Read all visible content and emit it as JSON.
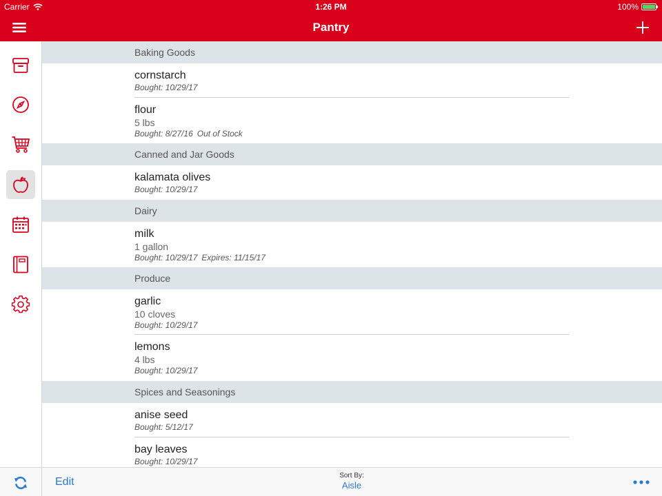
{
  "status_bar": {
    "carrier": "Carrier",
    "time": "1:26 PM",
    "battery": "100%",
    "battery_color": "#4cd964"
  },
  "nav_bar": {
    "title": "Pantry",
    "left_icon": "hamburger-menu-icon",
    "right_icon": "plus-icon",
    "color": "#d9001b"
  },
  "sidebar": {
    "items": [
      {
        "icon": "archive-box-icon",
        "active": false
      },
      {
        "icon": "compass-icon",
        "active": false
      },
      {
        "icon": "shopping-cart-icon",
        "active": false
      },
      {
        "icon": "apple-icon",
        "active": true
      },
      {
        "icon": "calendar-icon",
        "active": false
      },
      {
        "icon": "notebook-icon",
        "active": false
      },
      {
        "icon": "gear-icon",
        "active": false
      }
    ],
    "icon_color": "#d9001b"
  },
  "sections": [
    {
      "title": "Baking Goods",
      "items": [
        {
          "name": "cornstarch",
          "qty": "",
          "bought": "Bought: 10/29/17",
          "extra": ""
        },
        {
          "name": "flour",
          "qty": "5 lbs",
          "bought": "Bought: 8/27/16",
          "extra": "Out of Stock"
        }
      ]
    },
    {
      "title": "Canned and Jar Goods",
      "items": [
        {
          "name": "kalamata olives",
          "qty": "",
          "bought": "Bought: 10/29/17",
          "extra": ""
        }
      ]
    },
    {
      "title": "Dairy",
      "items": [
        {
          "name": "milk",
          "qty": "1 gallon",
          "bought": "Bought: 10/29/17",
          "extra": "Expires: 11/15/17"
        }
      ]
    },
    {
      "title": "Produce",
      "items": [
        {
          "name": "garlic",
          "qty": "10 cloves",
          "bought": "Bought: 10/29/17",
          "extra": ""
        },
        {
          "name": "lemons",
          "qty": "4 lbs",
          "bought": "Bought: 10/29/17",
          "extra": ""
        }
      ]
    },
    {
      "title": "Spices and Seasonings",
      "items": [
        {
          "name": "anise seed",
          "qty": "",
          "bought": "Bought: 5/12/17",
          "extra": ""
        },
        {
          "name": "bay leaves",
          "qty": "",
          "bought": "Bought: 10/29/17",
          "extra": ""
        }
      ]
    }
  ],
  "toolbar": {
    "edit_label": "Edit",
    "sort_label": "Sort By:",
    "sort_value": "Aisle",
    "sync_icon": "sync-icon",
    "more_icon": "more-icon",
    "accent": "#2a7ad2"
  }
}
